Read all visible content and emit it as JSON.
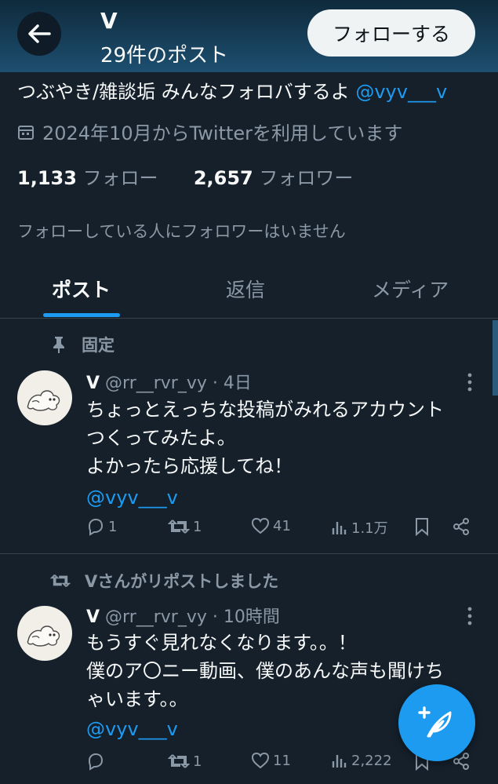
{
  "header": {
    "name": "V",
    "post_count": "29件のポスト",
    "follow_label": "フォローする"
  },
  "profile": {
    "bio_text": "つぶやき/雑談垢 みんなフォロバするよ ",
    "bio_link": "@vyv___v",
    "joined": "2024年10月からTwitterを利用しています",
    "following_count": "1,133",
    "following_label": "フォロー",
    "followers_count": "2,657",
    "followers_label": "フォロワー",
    "followers_you_know": "フォローしている人にフォロワーはいません"
  },
  "tabs": [
    {
      "label": "ポスト",
      "active": true
    },
    {
      "label": "返信",
      "active": false
    },
    {
      "label": "メディア",
      "active": false
    }
  ],
  "posts": [
    {
      "context": "固定",
      "context_icon": "pin-icon",
      "name": "V",
      "handle": "@rr__rvr_vy",
      "time": "· 4日",
      "lines": [
        "ちょっとえっちな投稿がみれるアカウント",
        "つくってみたよ。",
        "よかったら応援してね！"
      ],
      "mention": "@vyv___v",
      "replies": "1",
      "reposts": "1",
      "likes": "41",
      "views": "1.1万"
    },
    {
      "context": "Vさんがリポストしました",
      "context_icon": "repost-icon",
      "name": "V",
      "handle": "@rr__rvr_vy",
      "time": "· 10時間",
      "lines": [
        "もうすぐ見れなくなります。。！",
        "僕のア〇ニー動画、僕のあんな声も聞けち",
        "ゃいます。。"
      ],
      "mention": "@vyv___v",
      "replies": "",
      "reposts": "1",
      "likes": "11",
      "views": "2,222"
    }
  ],
  "colors": {
    "background": "#15202b",
    "accent": "#1d9bf0",
    "muted_text": "#8b98a5",
    "divider": "#38444d"
  }
}
